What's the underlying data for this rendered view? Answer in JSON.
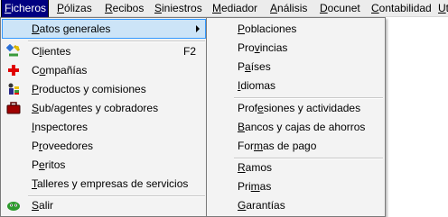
{
  "menubar": {
    "items": [
      {
        "pre": "",
        "u": "F",
        "post": "icheros",
        "active": true
      },
      {
        "pre": "",
        "u": "P",
        "post": "ólizas"
      },
      {
        "pre": "",
        "u": "R",
        "post": "ecibos"
      },
      {
        "pre": "",
        "u": "S",
        "post": "iniestros"
      },
      {
        "pre": "",
        "u": "M",
        "post": "ediador"
      },
      {
        "pre": "",
        "u": "A",
        "post": "nálisis"
      },
      {
        "pre": "",
        "u": "D",
        "post": "ocunet"
      },
      {
        "pre": "",
        "u": "C",
        "post": "ontabilidad"
      },
      {
        "pre": "",
        "u": "U",
        "post": "t"
      }
    ]
  },
  "ficheros_menu": {
    "items": [
      {
        "pre": "",
        "u": "D",
        "post": "atos generales",
        "icon": "none",
        "submenu": true
      },
      {
        "pre": "C",
        "u": "l",
        "post": "ientes",
        "icon": "clients-icon",
        "shortcut": "F2"
      },
      {
        "pre": "C",
        "u": "o",
        "post": "mpañías",
        "icon": "red-cross-icon"
      },
      {
        "pre": "",
        "u": "P",
        "post": "roductos y comisiones",
        "icon": "products-icon"
      },
      {
        "pre": "",
        "u": "S",
        "post": "ub/agentes y cobradores",
        "icon": "briefcase-icon"
      },
      {
        "pre": "",
        "u": "I",
        "post": "nspectores",
        "icon": "none"
      },
      {
        "pre": "P",
        "u": "r",
        "post": "oveedores",
        "icon": "none"
      },
      {
        "pre": "P",
        "u": "e",
        "post": "ritos",
        "icon": "none"
      },
      {
        "pre": "",
        "u": "T",
        "post": "alleres y empresas de servicios",
        "icon": "none"
      },
      {
        "pre": "",
        "u": "S",
        "post": "alir",
        "icon": "exit-icon"
      }
    ]
  },
  "datos_generales_submenu": {
    "items": [
      {
        "pre": "",
        "u": "P",
        "post": "oblaciones"
      },
      {
        "pre": "Pro",
        "u": "v",
        "post": "incias"
      },
      {
        "pre": "P",
        "u": "a",
        "post": "íses"
      },
      {
        "pre": "",
        "u": "I",
        "post": "diomas"
      },
      {
        "pre": "Prof",
        "u": "e",
        "post": "siones y actividades"
      },
      {
        "pre": "",
        "u": "B",
        "post": "ancos y cajas de ahorros"
      },
      {
        "pre": "For",
        "u": "m",
        "post": "as de pago"
      },
      {
        "pre": "",
        "u": "R",
        "post": "amos"
      },
      {
        "pre": "Pri",
        "u": "m",
        "post": "as"
      },
      {
        "pre": "",
        "u": "G",
        "post": "arantías"
      }
    ]
  }
}
